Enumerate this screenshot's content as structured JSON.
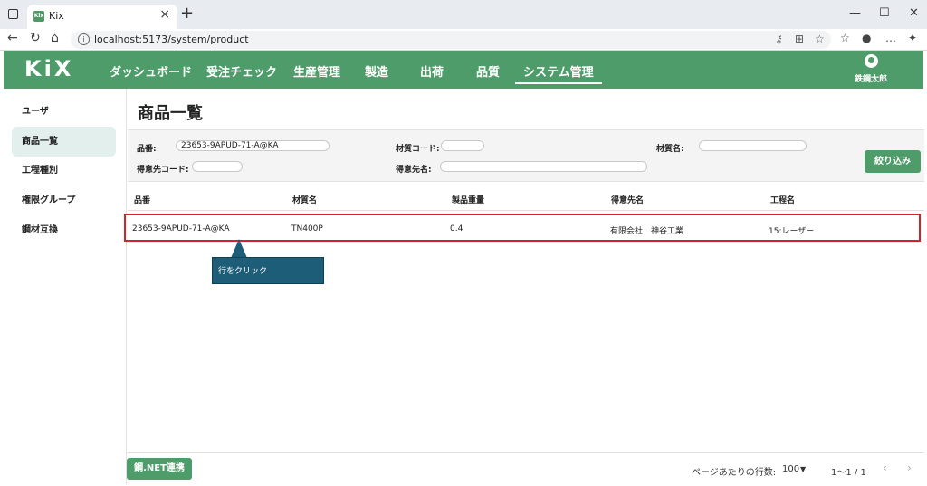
{
  "browser": {
    "tab_title": "Kix",
    "tab_favicon": "Kix",
    "url": "localhost:5173/system/product",
    "window_controls": [
      "—",
      "☐",
      "✕"
    ]
  },
  "app": {
    "logo": "KiX",
    "menu": [
      "ダッシュボード",
      "受注チェック",
      "生産管理",
      "製造",
      "出荷",
      "品質",
      "システム管理"
    ],
    "active_menu": "システム管理",
    "user_name": "鉄鋼太郎",
    "accent_color": "#4e9c6a"
  },
  "sidebar": {
    "items": [
      "ユーザ",
      "商品一覧",
      "工程種別",
      "権限グループ",
      "鋼材互換"
    ],
    "active": "商品一覧"
  },
  "page": {
    "title": "商品一覧"
  },
  "filters": {
    "hinban_label": "品番:",
    "hinban_value": "23653-9APUD-71-A@KA",
    "zaishitsu_code_label": "材質コード:",
    "zaishitsu_code_value": "",
    "zaishitsu_name_label": "材質名:",
    "zaishitsu_name_value": "",
    "tokuisaki_code_label": "得意先コード:",
    "tokuisaki_code_value": "",
    "tokuisaki_name_label": "得意先名:",
    "tokuisaki_name_value": "",
    "button_label": "絞り込み"
  },
  "table": {
    "columns": [
      "品番",
      "材質名",
      "製品重量",
      "得意先名",
      "工程名"
    ],
    "rows": [
      [
        "23653-9APUD-71-A@KA",
        "TN400P",
        "0.4",
        "有限会社　神谷工業",
        "15:レーザー"
      ]
    ]
  },
  "callout": {
    "text": "行をクリック"
  },
  "footer": {
    "net_button": "鋼.NET連携",
    "rows_per_page_label": "ページあたりの行数:",
    "rows_per_page_value": "100",
    "range": "1〜1 / 1"
  }
}
